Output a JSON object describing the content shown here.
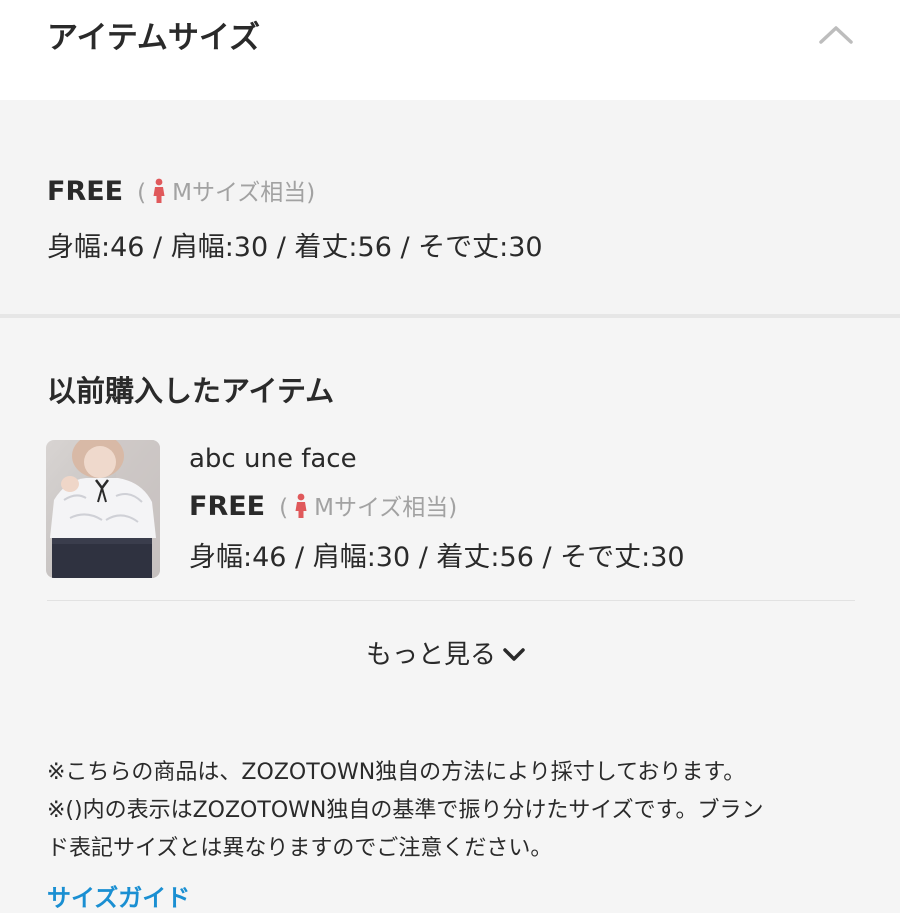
{
  "header": {
    "title": "アイテムサイズ",
    "collapse_icon": "chevron-up-icon"
  },
  "current_size": {
    "size_label": "FREE",
    "paren_open": "(",
    "equivalent": "Mサイズ相当",
    "paren_close": ")",
    "measurements": "身幅:46 / 肩幅:30 / 着丈:56 / そで丈:30",
    "person_icon_color": "#e0595b"
  },
  "previous": {
    "title": "以前購入したアイテム",
    "items": [
      {
        "brand": "abc une face",
        "size_label": "FREE",
        "paren_open": "(",
        "equivalent": "Mサイズ相当",
        "paren_close": ")",
        "measurements": "身幅:46 / 肩幅:30 / 着丈:56 / そで丈:30"
      }
    ],
    "more_label": "もっと見る"
  },
  "notes": {
    "line1": "※こちらの商品は、ZOZOTOWN独自の方法により採寸しております。",
    "line2": "※()内の表示はZOZOTOWN独自の基準で振り分けたサイズです。ブラン",
    "line3": "ド表記サイズとは異なりますのでご注意ください。"
  },
  "size_guide_link": "サイズガイド",
  "colors": {
    "accent_link": "#1a8fd2",
    "page_bg": "#f5f5f5",
    "header_bg": "#ffffff"
  }
}
